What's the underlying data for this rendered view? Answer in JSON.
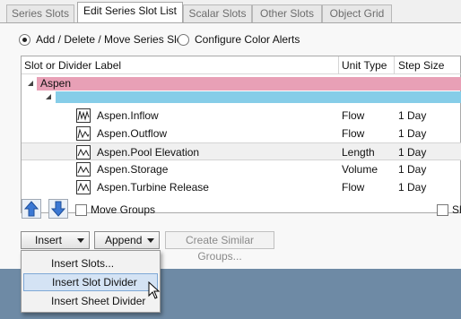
{
  "tabs": [
    "Series Slots",
    "Edit Series Slot List",
    "Scalar Slots",
    "Other Slots",
    "Object Grid"
  ],
  "active_tab": "Edit Series Slot List",
  "mode": {
    "option_add": "Add / Delete / Move Series Slot",
    "option_alerts": "Configure Color Alerts"
  },
  "grid": {
    "columns": [
      "Slot or Divider Label",
      "Unit Type",
      "Step Size"
    ],
    "group": {
      "label": "Aspen",
      "color": "#e8a0b6",
      "child_color": "#86cde8"
    },
    "rows": [
      {
        "label": "Aspen.Inflow",
        "unit": "Flow",
        "step": "1 Day"
      },
      {
        "label": "Aspen.Outflow",
        "unit": "Flow",
        "step": "1 Day"
      },
      {
        "label": "Aspen.Pool Elevation",
        "unit": "Length",
        "step": "1 Day"
      },
      {
        "label": "Aspen.Storage",
        "unit": "Volume",
        "step": "1 Day"
      },
      {
        "label": "Aspen.Turbine Release",
        "unit": "Flow",
        "step": "1 Day"
      }
    ]
  },
  "move_groups_label": "Move Groups",
  "show_label": "Sh",
  "buttons": {
    "insert": "Insert",
    "append": "Append",
    "create_similar": "Create Similar Groups..."
  },
  "menu": {
    "items": [
      "Insert Slots...",
      "Insert Slot Divider",
      "Insert Sheet Divider"
    ],
    "highlighted": "Insert Slot Divider"
  }
}
